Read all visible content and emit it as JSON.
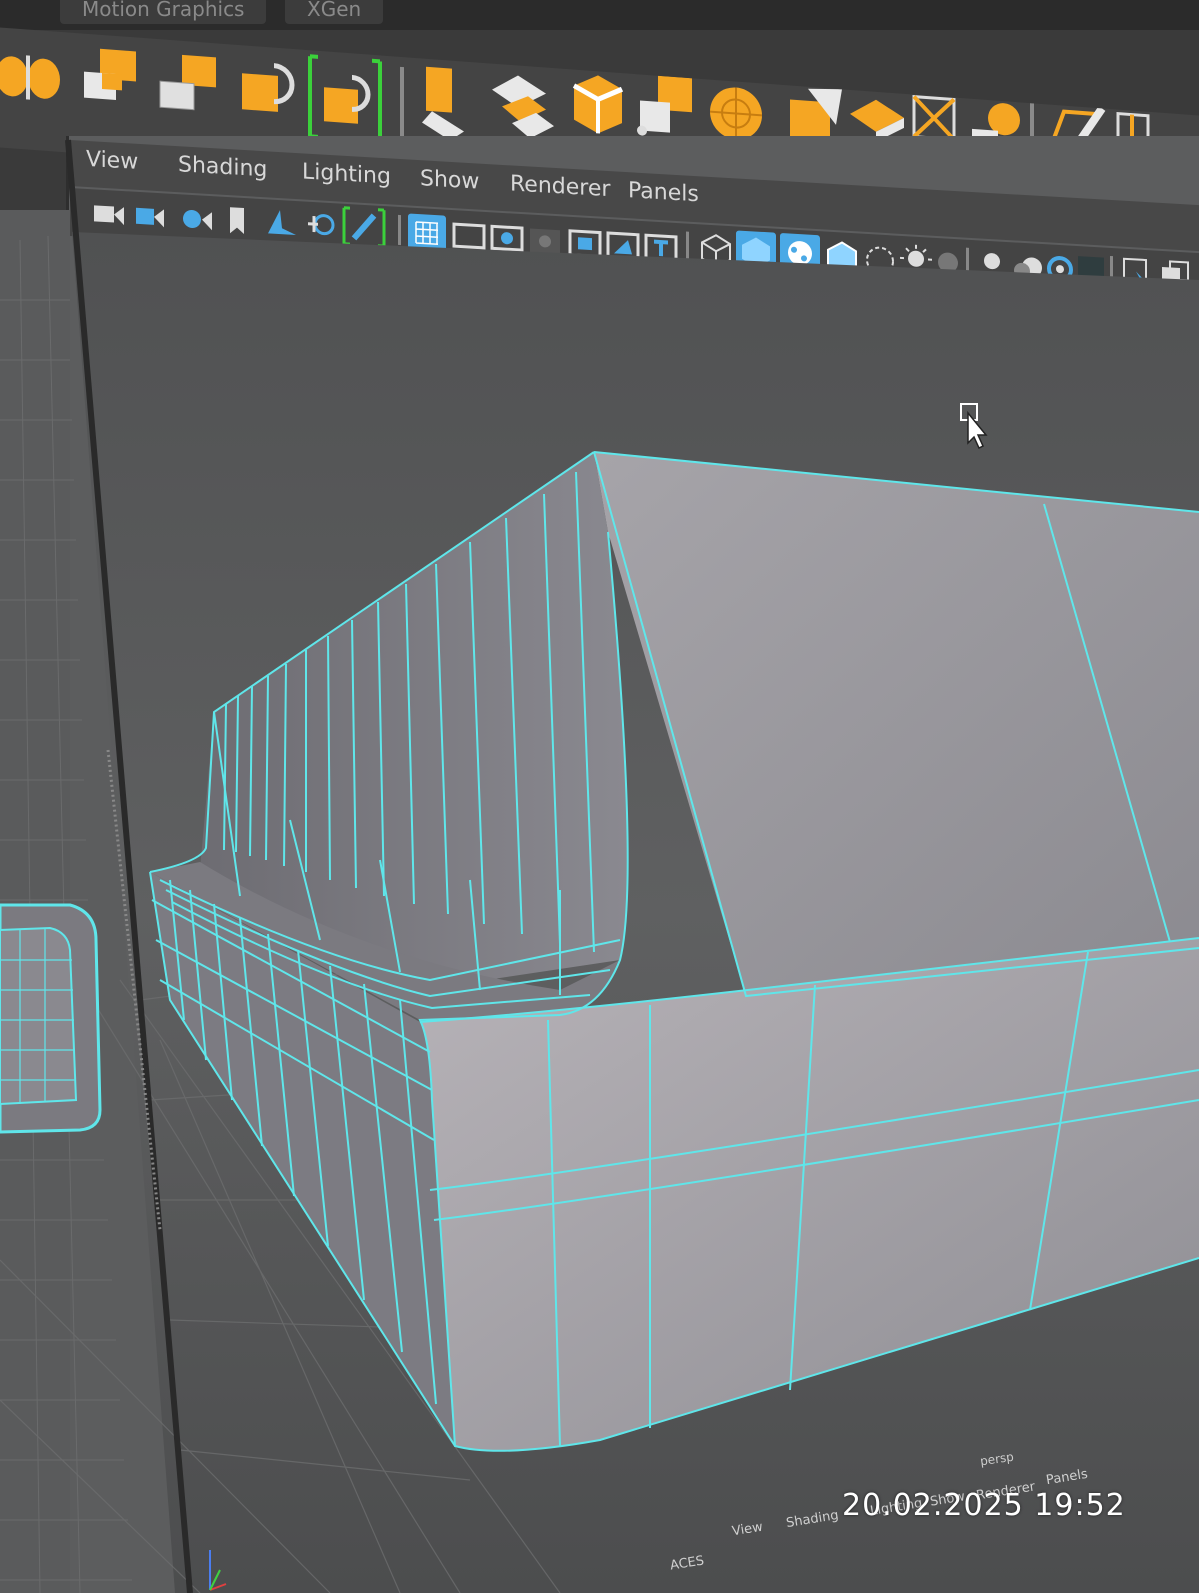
{
  "shelf_tabs": [
    "Motion Graphics",
    "XGen"
  ],
  "menu": [
    "View",
    "Shading",
    "Lighting",
    "Show",
    "Renderer",
    "Panels"
  ],
  "viewport_icons": [
    "camera-icon",
    "camera-lock-icon",
    "camera-attributes-icon",
    "bookmark-icon",
    "image-plane-icon",
    "2d-pan-zoom-icon",
    "grease-pencil-icon",
    "grid-icon",
    "film-gate-icon",
    "resolution-gate-icon",
    "gate-mask-icon",
    "field-chart-icon",
    "safe-action-icon",
    "safe-title-icon",
    "wireframe-icon",
    "smooth-shade-icon",
    "use-default-material-icon",
    "wireframe-on-shaded-icon",
    "xray-icon",
    "use-all-lights-icon",
    "shadows-icon",
    "screen-space-ao-icon",
    "motion-blur-icon",
    "anti-aliasing-icon",
    "depth-of-field-icon",
    "isolate-select-icon",
    "xray-joints-icon"
  ],
  "shelf_icons": [
    "symmetry-icon",
    "combine-icon",
    "separate-icon",
    "bool-union-icon",
    "bool-difference-icon",
    "extrude-icon",
    "bridge-icon",
    "bevel-icon",
    "append-to-polygon-icon",
    "fill-hole-icon",
    "multi-cut-icon",
    "target-weld-icon",
    "connect-icon",
    "quad-draw-icon",
    "edit-edge-flow-icon"
  ],
  "mini_viewport": {
    "label": "persp",
    "menu": [
      "View",
      "Shading",
      "Lighting",
      "Show",
      "Renderer",
      "Panels"
    ],
    "color_space": "ACES"
  },
  "timestamp": "20.02.2025  19:52",
  "colors": {
    "wireframe": "#5fe6ea",
    "accent_orange": "#f5a623",
    "active_blue": "#4aa9e6"
  }
}
